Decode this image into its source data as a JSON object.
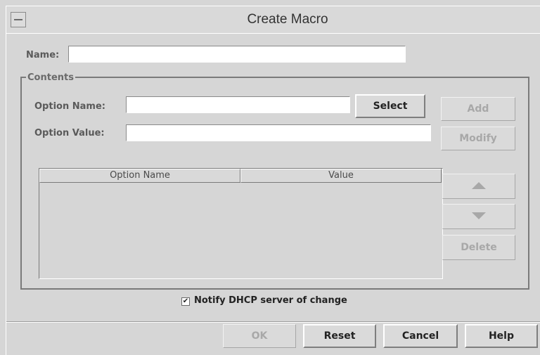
{
  "window": {
    "title": "Create Macro"
  },
  "name_field": {
    "label": "Name:",
    "value": ""
  },
  "contents": {
    "title": "Contents",
    "option_name_label": "Option Name:",
    "option_name_value": "",
    "option_value_label": "Option Value:",
    "option_value_value": "",
    "select_button": "Select",
    "add_button": "Add",
    "modify_button": "Modify",
    "delete_button": "Delete",
    "move_up_icon": "up-arrow-icon",
    "move_down_icon": "down-arrow-icon",
    "table": {
      "columns": [
        "Option Name",
        "Value"
      ],
      "rows": []
    }
  },
  "notify": {
    "label": "Notify DHCP server of change",
    "checked": true,
    "check_glyph": "✔"
  },
  "footer": {
    "ok": "OK",
    "reset": "Reset",
    "cancel": "Cancel",
    "help": "Help"
  }
}
